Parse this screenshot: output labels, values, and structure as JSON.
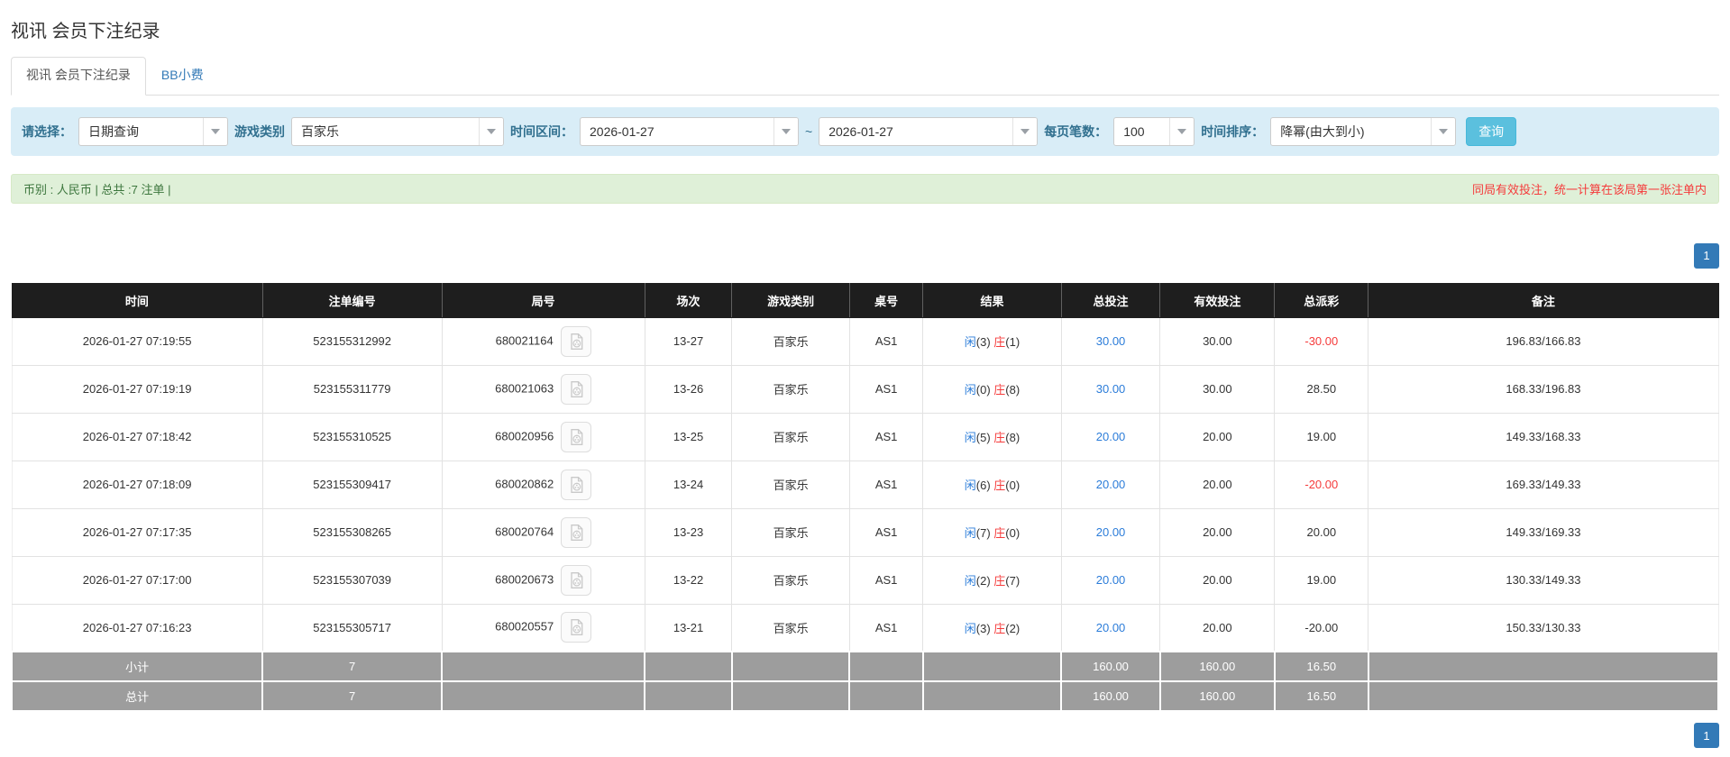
{
  "colors": {
    "accent": "#337ab7",
    "link": "#2b7cd9",
    "red": "#f53b3b",
    "header-bg": "#1e1e1e",
    "footer-bg": "#9d9d9d",
    "filter-bg": "#d9edf7",
    "summary-bg": "#dff0d8",
    "btn-info": "#5bc0de"
  },
  "page": {
    "title": "视讯 会员下注纪录"
  },
  "tabs": [
    {
      "label": "视讯 会员下注纪录",
      "active": true
    },
    {
      "label": "BB小费",
      "active": false
    }
  ],
  "filters": {
    "select_label": "请选择：",
    "select_value": "日期查询",
    "game_type_label": "游戏类别",
    "game_type_value": "百家乐",
    "date_range_label": "时间区间：",
    "date_from": "2026-01-27",
    "date_separator": "~",
    "date_to": "2026-01-27",
    "page_size_label": "每页笔数：",
    "page_size_value": "100",
    "sort_label": "时间排序：",
    "sort_value": "降幂(由大到小)",
    "query_button": "查询"
  },
  "summary": {
    "left": "币别 : 人民币 | 总共 :7 注单 |",
    "right": "同局有效投注，统一计算在该局第一张注单内"
  },
  "pagination": {
    "page": "1"
  },
  "table": {
    "columns": [
      "时间",
      "注单编号",
      "局号",
      "场次",
      "游戏类别",
      "桌号",
      "结果",
      "总投注",
      "有效投注",
      "总派彩",
      "备注"
    ],
    "rows": [
      {
        "time": "2026-01-27 07:19:55",
        "bet_id": "523155312992",
        "round_id": "680021164",
        "session": "13-27",
        "game": "百家乐",
        "table_no": "AS1",
        "player_label": "闲",
        "player_value": "(3)",
        "banker_label": "庄",
        "banker_value": "(1)",
        "total_bet": "30.00",
        "valid_bet": "30.00",
        "payout": "-30.00",
        "payout_neg": true,
        "remark": "196.83/166.83"
      },
      {
        "time": "2026-01-27 07:19:19",
        "bet_id": "523155311779",
        "round_id": "680021063",
        "session": "13-26",
        "game": "百家乐",
        "table_no": "AS1",
        "player_label": "闲",
        "player_value": "(0)",
        "banker_label": "庄",
        "banker_value": "(8)",
        "total_bet": "30.00",
        "valid_bet": "30.00",
        "payout": "28.50",
        "payout_neg": false,
        "remark": "168.33/196.83"
      },
      {
        "time": "2026-01-27 07:18:42",
        "bet_id": "523155310525",
        "round_id": "680020956",
        "session": "13-25",
        "game": "百家乐",
        "table_no": "AS1",
        "player_label": "闲",
        "player_value": "(5)",
        "banker_label": "庄",
        "banker_value": "(8)",
        "total_bet": "20.00",
        "valid_bet": "20.00",
        "payout": "19.00",
        "payout_neg": false,
        "remark": "149.33/168.33"
      },
      {
        "time": "2026-01-27 07:18:09",
        "bet_id": "523155309417",
        "round_id": "680020862",
        "session": "13-24",
        "game": "百家乐",
        "table_no": "AS1",
        "player_label": "闲",
        "player_value": "(6)",
        "banker_label": "庄",
        "banker_value": "(0)",
        "total_bet": "20.00",
        "valid_bet": "20.00",
        "payout": "-20.00",
        "payout_neg": true,
        "remark": "169.33/149.33"
      },
      {
        "time": "2026-01-27 07:17:35",
        "bet_id": "523155308265",
        "round_id": "680020764",
        "session": "13-23",
        "game": "百家乐",
        "table_no": "AS1",
        "player_label": "闲",
        "player_value": "(7)",
        "banker_label": "庄",
        "banker_value": "(0)",
        "total_bet": "20.00",
        "valid_bet": "20.00",
        "payout": "20.00",
        "payout_neg": false,
        "remark": "149.33/169.33"
      },
      {
        "time": "2026-01-27 07:17:00",
        "bet_id": "523155307039",
        "round_id": "680020673",
        "session": "13-22",
        "game": "百家乐",
        "table_no": "AS1",
        "player_label": "闲",
        "player_value": "(2)",
        "banker_label": "庄",
        "banker_value": "(7)",
        "total_bet": "20.00",
        "valid_bet": "20.00",
        "payout": "19.00",
        "payout_neg": false,
        "remark": "130.33/149.33"
      },
      {
        "time": "2026-01-27 07:16:23",
        "bet_id": "523155305717",
        "round_id": "680020557",
        "session": "13-21",
        "game": "百家乐",
        "table_no": "AS1",
        "player_label": "闲",
        "player_value": "(3)",
        "banker_label": "庄",
        "banker_value": "(2)",
        "total_bet": "20.00",
        "valid_bet": "20.00",
        "payout": "-20.00",
        "payout_neg": false,
        "remark": "150.33/130.33"
      }
    ],
    "footer": [
      {
        "label": "小计",
        "count": "7",
        "total_bet": "160.00",
        "valid_bet": "160.00",
        "payout": "16.50"
      },
      {
        "label": "总计",
        "count": "7",
        "total_bet": "160.00",
        "valid_bet": "160.00",
        "payout": "16.50"
      }
    ]
  }
}
